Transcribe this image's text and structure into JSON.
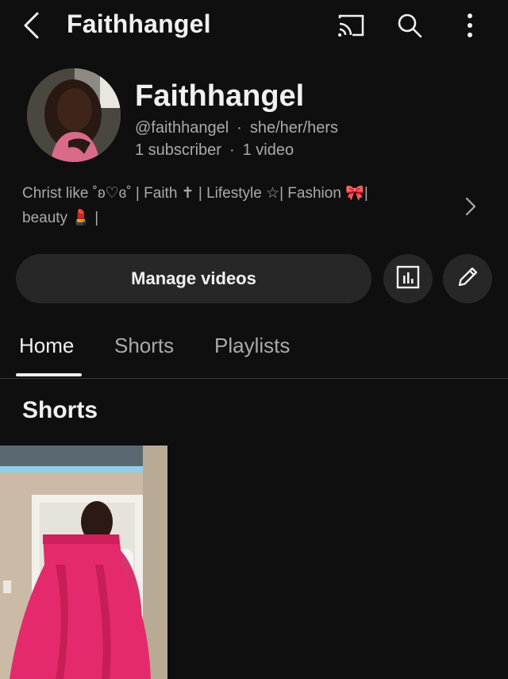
{
  "topbar": {
    "title": "Faithhangel",
    "back_icon": "chevron-left-icon",
    "cast_icon": "cast-icon",
    "search_icon": "search-icon",
    "more_icon": "more-vertical-icon"
  },
  "channel": {
    "name": "Faithhangel",
    "handle": "@faithhangel",
    "pronouns": "she/her/hers",
    "subscribers": "1 subscriber",
    "videos": "1 video",
    "description_line1": "Christ like ˚ʚ♡ɞ˚ | Faith ✝ | Lifestyle ☆| Fashion 🎀|",
    "description_line2": "beauty 💄 |"
  },
  "actions": {
    "manage_videos": "Manage videos",
    "analytics_icon": "analytics-icon",
    "edit_icon": "pencil-icon"
  },
  "tabs": [
    {
      "label": "Home",
      "active": true
    },
    {
      "label": "Shorts",
      "active": false
    },
    {
      "label": "Playlists",
      "active": false
    }
  ],
  "sections": {
    "shorts_title": "Shorts"
  },
  "colors": {
    "background": "#0f0f0f",
    "text": "#f1f1f1",
    "secondary_text": "#aaaaaa",
    "button_bg": "#272727"
  }
}
